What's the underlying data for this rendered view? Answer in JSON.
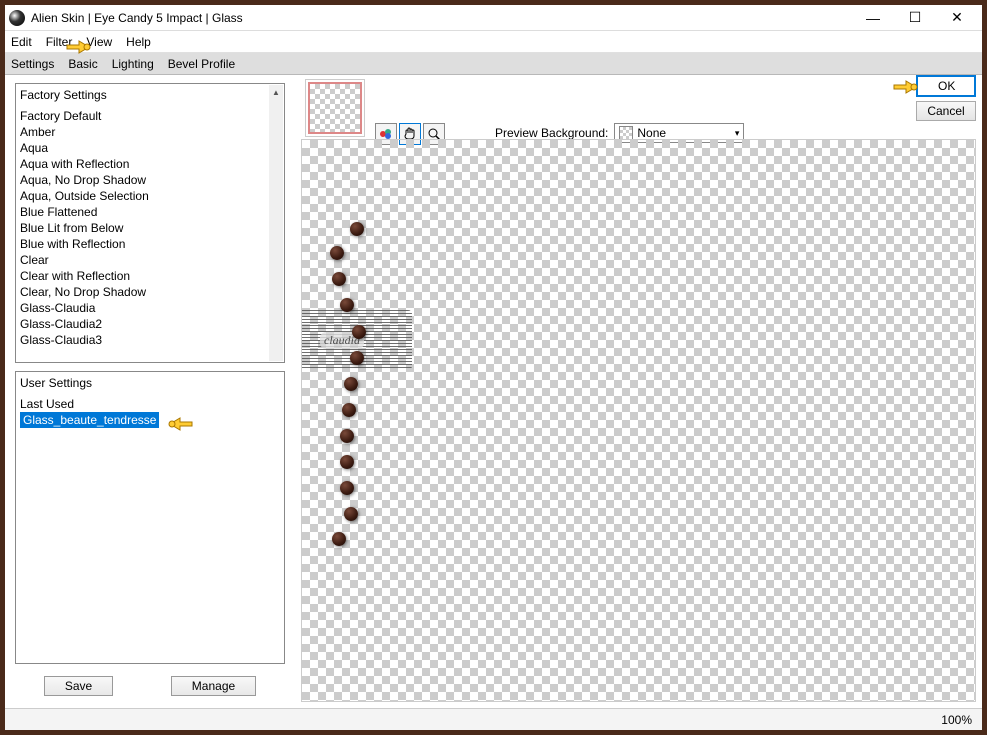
{
  "window": {
    "title": "Alien Skin | Eye Candy 5 Impact | Glass"
  },
  "menu": {
    "edit": "Edit",
    "filter": "Filter",
    "view": "View",
    "help": "Help"
  },
  "tabs": {
    "settings": "Settings",
    "basic": "Basic",
    "lighting": "Lighting",
    "bevel": "Bevel Profile"
  },
  "factory": {
    "header": "Factory Settings",
    "items": [
      "Factory Default",
      "Amber",
      "Aqua",
      "Aqua with Reflection",
      "Aqua, No Drop Shadow",
      "Aqua, Outside Selection",
      "Blue Flattened",
      "Blue Lit from Below",
      "Blue with Reflection",
      "Clear",
      "Clear with Reflection",
      "Clear, No Drop Shadow",
      "Glass-Claudia",
      "Glass-Claudia2",
      "Glass-Claudia3"
    ]
  },
  "user": {
    "header": "User Settings",
    "items": [
      "Last Used",
      "Glass_beaute_tendresse"
    ],
    "selected_index": 1
  },
  "buttons": {
    "save": "Save",
    "manage": "Manage",
    "ok": "OK",
    "cancel": "Cancel"
  },
  "preview": {
    "bg_label": "Preview Background:",
    "bg_value": "None",
    "watermark": "claudia"
  },
  "status": {
    "zoom": "100%"
  }
}
